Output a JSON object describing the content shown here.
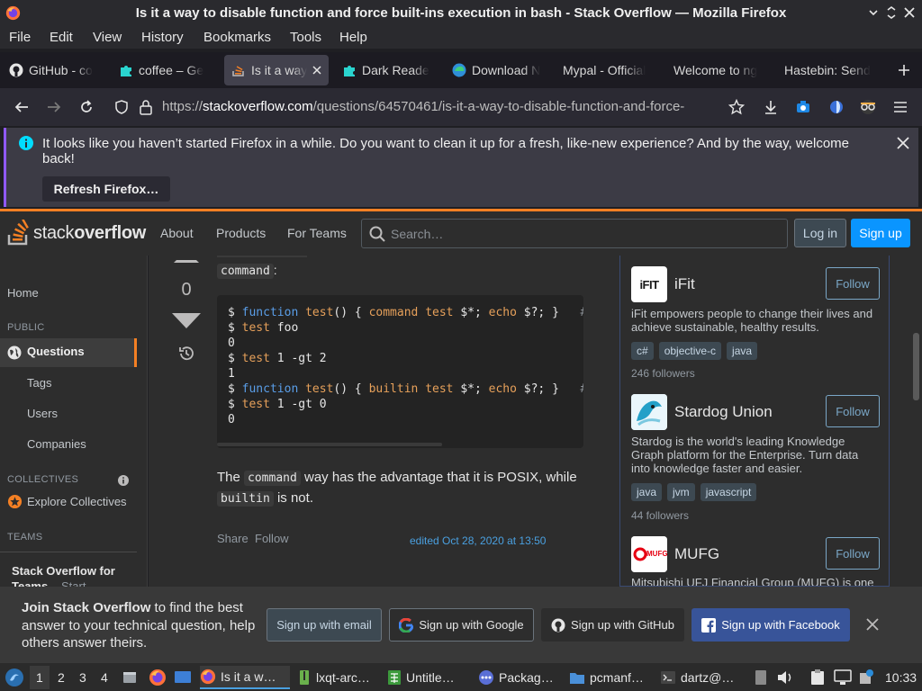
{
  "window": {
    "title": "Is it a way to disable function and force built-ins execution in bash - Stack Overflow — Mozilla Firefox"
  },
  "menubar": {
    "items": [
      "File",
      "Edit",
      "View",
      "History",
      "Bookmarks",
      "Tools",
      "Help"
    ]
  },
  "tabs": [
    {
      "label": "GitHub - co",
      "icon": "github-icon"
    },
    {
      "label": "coffee – Ge",
      "icon": "puzzle-icon"
    },
    {
      "label": "Is it a way",
      "icon": "stackoverflow-icon",
      "active": true
    },
    {
      "label": "Dark Reade",
      "icon": "puzzle-icon"
    },
    {
      "label": "Download N",
      "icon": "edge-icon"
    },
    {
      "label": "Mypal - Official",
      "icon": "none"
    },
    {
      "label": "Welcome to ng",
      "icon": "none"
    },
    {
      "label": "Hastebin: Send",
      "icon": "none"
    }
  ],
  "navbar": {
    "url_prefix": "https://",
    "url_host": "stackoverflow.com",
    "url_path": "/questions/64570461/is-it-a-way-to-disable-function-and-force-"
  },
  "notification": {
    "message": "It looks like you haven’t started Firefox in a while. Do you want to clean it up for a fresh, like-new experience? And by the way, welcome back!",
    "button_label": "Refresh Firefox…"
  },
  "so_header": {
    "logo_text_light": "stack",
    "logo_text_bold": "overflow",
    "nav": [
      "About",
      "Products",
      "For Teams"
    ],
    "search_placeholder": "Search…",
    "login_label": "Log in",
    "signup_label": "Sign up"
  },
  "left_sidebar": {
    "home": "Home",
    "public_heading": "PUBLIC",
    "questions": "Questions",
    "tags": "Tags",
    "users": "Users",
    "companies": "Companies",
    "collectives_heading": "COLLECTIVES",
    "explore_collectives": "Explore Collectives",
    "teams_heading": "TEAMS",
    "teams_promo_line1": "Stack Overflow for",
    "teams_promo_line2": "Teams",
    "teams_promo_start": "Start"
  },
  "answer": {
    "vote_count": "0",
    "intro_code": "command",
    "intro_suffix": ":",
    "code_lines": [
      [
        [
          "$ ",
          ""
        ],
        [
          "function",
          "kw"
        ],
        [
          " ",
          ""
        ],
        [
          "test",
          "fn"
        ],
        [
          "() { ",
          ""
        ],
        [
          "command",
          "fn"
        ],
        [
          " ",
          ""
        ],
        [
          "test",
          "fn"
        ],
        [
          " $*; ",
          ""
        ],
        [
          "echo",
          "fn"
        ],
        [
          " $?; }   ",
          ""
        ],
        [
          "#",
          "cm"
        ]
      ],
      [
        [
          "$ ",
          ""
        ],
        [
          "test",
          "fn"
        ],
        [
          " foo",
          ""
        ]
      ],
      [
        [
          "0",
          ""
        ]
      ],
      [
        [
          "$ ",
          ""
        ],
        [
          "test",
          "fn"
        ],
        [
          " 1 -gt 2",
          ""
        ]
      ],
      [
        [
          "1",
          ""
        ]
      ],
      [
        [
          "$ ",
          ""
        ],
        [
          "function",
          "kw"
        ],
        [
          " ",
          ""
        ],
        [
          "test",
          "fn"
        ],
        [
          "() { ",
          ""
        ],
        [
          "builtin",
          "fn"
        ],
        [
          " ",
          ""
        ],
        [
          "test",
          "fn"
        ],
        [
          " $*; ",
          ""
        ],
        [
          "echo",
          "fn"
        ],
        [
          " $?; }   ",
          ""
        ],
        [
          "#",
          "cm"
        ]
      ],
      [
        [
          "$ ",
          ""
        ],
        [
          "test",
          "fn"
        ],
        [
          " 1 -gt 0",
          ""
        ]
      ],
      [
        [
          "0",
          ""
        ]
      ]
    ],
    "para_the": "The",
    "para_code1": "command",
    "para_mid": "way has the advantage that it is POSIX, while",
    "para_code2": "builtin",
    "para_end": "is not.",
    "share": "Share",
    "follow": "Follow",
    "edited": "edited Oct 28, 2020 at 13:50"
  },
  "collectives": [
    {
      "name": "iFit",
      "follow": "Follow",
      "description": "iFit empowers people to change their lives and achieve sustainable, healthy results.",
      "tags": [
        "c#",
        "objective-c",
        "java"
      ],
      "followers": "246 followers",
      "logo_text": "iFIT"
    },
    {
      "name": "Stardog Union",
      "follow": "Follow",
      "description": "Stardog is the world's leading Knowledge Graph platform for the Enterprise. Turn data into knowledge faster and easier.",
      "tags": [
        "java",
        "jvm",
        "javascript"
      ],
      "followers": "44 followers"
    },
    {
      "name": "MUFG",
      "follow": "Follow",
      "description": "Mitsubishi UFJ Financial Group (MUFG) is one",
      "logo_text": "MUFG"
    }
  ],
  "banner": {
    "bold": "Join Stack Overflow",
    "text": " to find the best answer to your technical question, help others answer theirs.",
    "email_label": "Sign up with email",
    "google_label": "Sign up with Google",
    "github_label": "Sign up with GitHub",
    "facebook_label": "Sign up with Facebook"
  },
  "taskbar": {
    "workspaces": [
      "1",
      "2",
      "3",
      "4"
    ],
    "tasks": [
      {
        "label": "Is it a w…",
        "icon": "firefox-icon",
        "active": true
      },
      {
        "label": "lxqt-arc…",
        "icon": "archive-icon"
      },
      {
        "label": "Untitle…",
        "icon": "spreadsheet-icon"
      },
      {
        "label": "Packag…",
        "icon": "package-icon"
      },
      {
        "label": "pcmanf…",
        "icon": "folder-icon"
      },
      {
        "label": "dartz@…",
        "icon": "terminal-icon"
      }
    ],
    "clock": "10:33"
  },
  "colors": {
    "so_orange": "#f48024",
    "so_blue": "#0a95ff",
    "facebook_blue": "#385499",
    "firefox_purple": "#9059ff"
  }
}
